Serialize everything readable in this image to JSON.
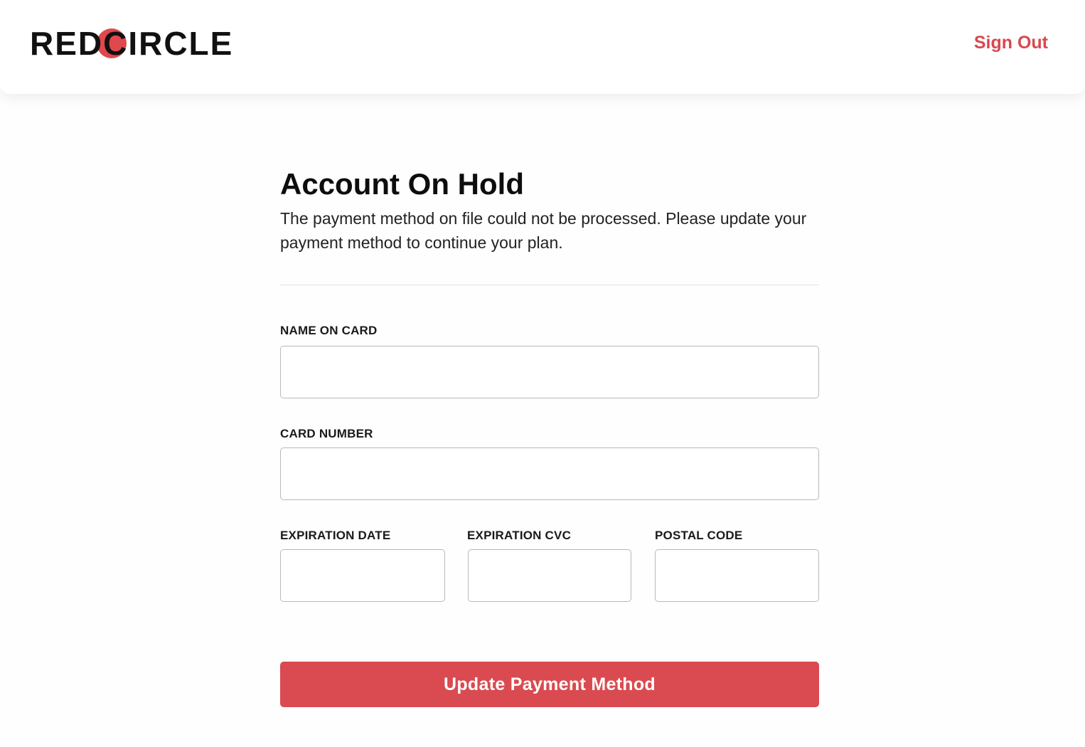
{
  "header": {
    "logo_text": "REDCIRCLE",
    "sign_out_label": "Sign Out"
  },
  "main": {
    "title": "Account On Hold",
    "message": "The payment method on file could not be processed. Please update your payment method to continue your plan."
  },
  "form": {
    "name_on_card": {
      "label": "NAME ON CARD",
      "value": ""
    },
    "card_number": {
      "label": "CARD NUMBER",
      "value": ""
    },
    "expiration_date": {
      "label": "EXPIRATION DATE",
      "value": ""
    },
    "expiration_cvc": {
      "label": "EXPIRATION CVC",
      "value": ""
    },
    "postal_code": {
      "label": "POSTAL CODE",
      "value": ""
    },
    "submit_label": "Update Payment Method"
  },
  "colors": {
    "brand_red": "#d94b50",
    "logo_dot": "#e0484d",
    "text": "#111111",
    "input_border": "#b8b8b8"
  }
}
